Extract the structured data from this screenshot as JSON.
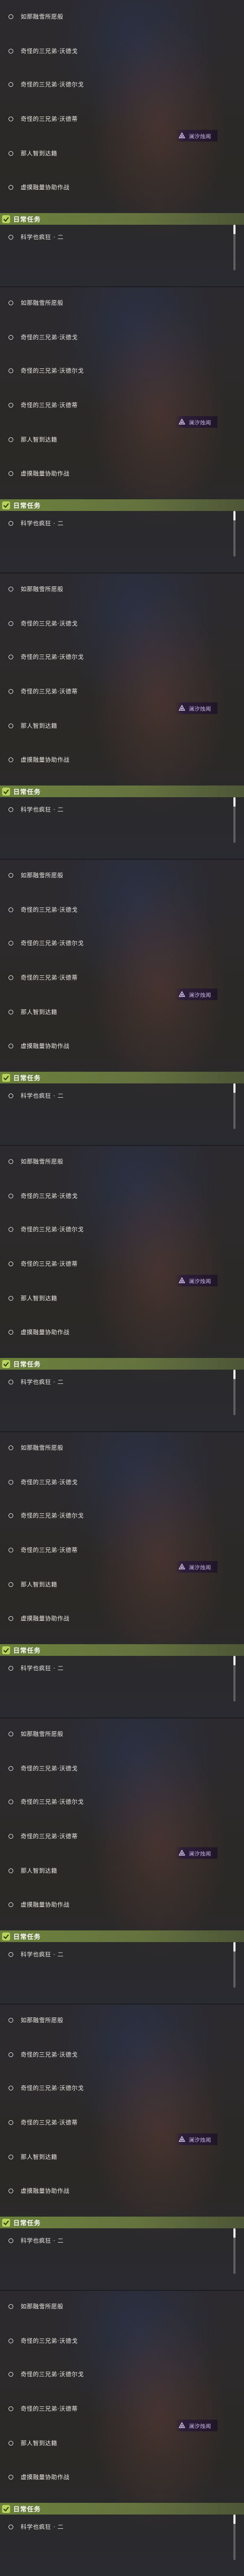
{
  "quest_panels": [
    {
      "quests": [
        "如那融雪所愿般",
        "奇怪的三兄弟·沃德戈",
        "奇怪的三兄弟·沃德尔戈",
        "奇怪的三兄弟·沃德蒂",
        "那人智到达籍",
        "虚摸融量协助作战"
      ],
      "badge_text": "澜汐烛闻",
      "daily_header": "日常任务",
      "daily_quests": [
        "科学也疯狂 · 二"
      ]
    },
    {
      "quests": [
        "如那融雪所愿般",
        "奇怪的三兄弟·沃德戈",
        "奇怪的三兄弟·沃德尔戈",
        "奇怪的三兄弟·沃德蒂",
        "那人智到达籍",
        "虚摸融量协助作战"
      ],
      "badge_text": "澜汐烛闻",
      "daily_header": "日常任务",
      "daily_quests": [
        "科学也疯狂 · 二"
      ]
    },
    {
      "quests": [
        "如那融雪所愿般",
        "奇怪的三兄弟·沃德戈",
        "奇怪的三兄弟·沃德尔戈",
        "奇怪的三兄弟·沃德蒂",
        "那人智到达籍",
        "虚摸融量协助作战"
      ],
      "badge_text": "澜汐烛闻",
      "daily_header": "日常任务",
      "daily_quests": [
        "科学也疯狂 · 二"
      ]
    },
    {
      "quests": [
        "如那融雪所愿般",
        "奇怪的三兄弟·沃德戈",
        "奇怪的三兄弟·沃德尔戈",
        "奇怪的三兄弟·沃德蒂",
        "那人智到达籍",
        "虚摸融量协助作战"
      ],
      "badge_text": "澜汐烛闻",
      "daily_header": "日常任务",
      "daily_quests": [
        "科学也疯狂 · 二"
      ]
    },
    {
      "quests": [
        "如那融雪所愿般",
        "奇怪的三兄弟·沃德戈",
        "奇怪的三兄弟·沃德尔戈",
        "奇怪的三兄弟·沃德蒂",
        "那人智到达籍",
        "虚摸融量协助作战"
      ],
      "badge_text": "澜汐烛闻",
      "daily_header": "日常任务",
      "daily_quests": [
        "科学也疯狂 · 二"
      ]
    },
    {
      "quests": [
        "如那融雪所愿般",
        "奇怪的三兄弟·沃德戈",
        "奇怪的三兄弟·沃德尔戈",
        "奇怪的三兄弟·沃德蒂",
        "那人智到达籍",
        "虚摸融量协助作战"
      ],
      "badge_text": "澜汐烛闻",
      "daily_header": "日常任务",
      "daily_quests": [
        "科学也疯狂 · 二"
      ]
    },
    {
      "quests": [
        "如那融雪所愿般",
        "奇怪的三兄弟·沃德戈",
        "奇怪的三兄弟·沃德尔戈",
        "奇怪的三兄弟·沃德蒂",
        "那人智到达籍",
        "虚摸融量协助作战"
      ],
      "badge_text": "澜汐烛闻",
      "daily_header": "日常任务",
      "daily_quests": [
        "科学也疯狂 · 二"
      ]
    },
    {
      "quests": [
        "如那融雪所愿般",
        "奇怪的三兄弟·沃德戈",
        "奇怪的三兄弟·沃德尔戈",
        "奇怪的三兄弟·沃德蒂",
        "那人智到达籍",
        "虚摸融量协助作战"
      ],
      "badge_text": "澜汐烛闻",
      "daily_header": "日常任务",
      "daily_quests": [
        "科学也疯狂 · 二"
      ]
    },
    {
      "quests": [
        "如那融雪所愿般",
        "奇怪的三兄弟·沃德戈",
        "奇怪的三兄弟·沃德尔戈",
        "奇怪的三兄弟·沃德蒂",
        "那人智到达籍",
        "虚摸融量协助作战"
      ],
      "badge_text": "澜汐烛闻",
      "daily_header": "日常任务",
      "daily_quests": [
        "科学也疯狂 · 二"
      ]
    }
  ],
  "colors": {
    "daily_accent": "#b9d45a",
    "badge_accent": "#cbb8ea"
  },
  "icons": {
    "quest_bullet": "ring-icon",
    "daily": "daily-quest-icon",
    "badge": "domain-seal-icon"
  }
}
